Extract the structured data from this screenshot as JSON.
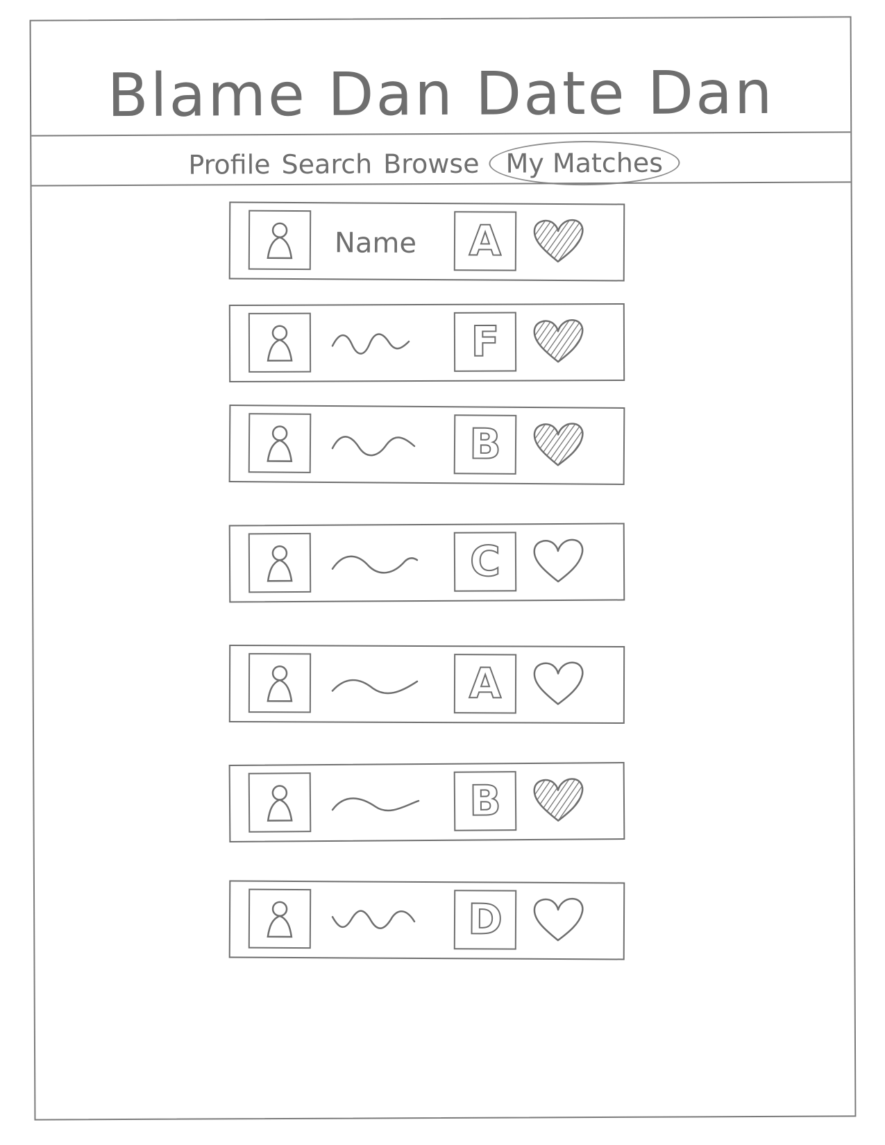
{
  "app": {
    "title": "Blame Dan Date Dan"
  },
  "nav": {
    "items": [
      {
        "label": "Profile",
        "active": false
      },
      {
        "label": "Search",
        "active": false
      },
      {
        "label": "Browse",
        "active": false
      },
      {
        "label": "My Matches",
        "active": true
      }
    ]
  },
  "matches": [
    {
      "name": "Name",
      "grade": "A",
      "favorited": true
    },
    {
      "name": "",
      "grade": "F",
      "favorited": true
    },
    {
      "name": "",
      "grade": "B",
      "favorited": true
    },
    {
      "name": "",
      "grade": "C",
      "favorited": false
    },
    {
      "name": "",
      "grade": "A",
      "favorited": false
    },
    {
      "name": "",
      "grade": "B",
      "favorited": true
    },
    {
      "name": "",
      "grade": "D",
      "favorited": false
    }
  ],
  "colors": {
    "ink": "#6e6e6e",
    "paper": "#ffffff"
  }
}
